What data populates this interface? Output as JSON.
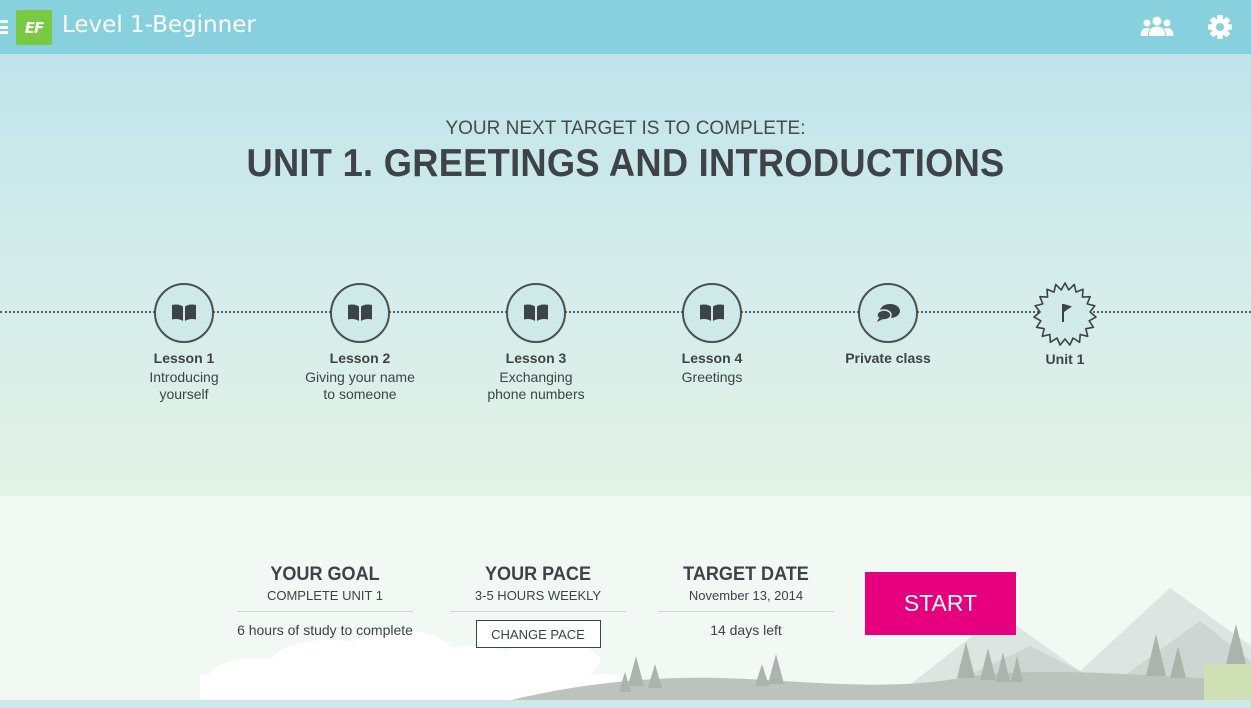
{
  "topbar": {
    "logo_text": "EF",
    "title": "Level 1-Beginner",
    "icons": [
      "menu-icon",
      "people-icon",
      "gear-icon"
    ]
  },
  "hero": {
    "kicker": "YOUR NEXT TARGET IS TO COMPLETE:",
    "unit_title": "UNIT 1. GREETINGS AND INTRODUCTIONS",
    "steps": [
      {
        "name": "Lesson 1",
        "desc": "Introducing yourself",
        "icon": "book-icon"
      },
      {
        "name": "Lesson 2",
        "desc": "Giving your name to someone",
        "icon": "book-icon"
      },
      {
        "name": "Lesson 3",
        "desc": "Exchanging phone numbers",
        "icon": "book-icon"
      },
      {
        "name": "Lesson 4",
        "desc": "Greetings",
        "icon": "book-icon"
      },
      {
        "name": "Private class",
        "desc": "",
        "icon": "chat-icon"
      },
      {
        "name": "Unit 1",
        "desc": "",
        "icon": "flag-badge-icon"
      }
    ]
  },
  "goal": {
    "head": "YOUR GOAL",
    "sub": "COMPLETE UNIT 1",
    "note": "6 hours of study to complete"
  },
  "pace": {
    "head": "YOUR PACE",
    "sub": "3-5 HOURS WEEKLY",
    "button": "CHANGE PACE"
  },
  "target": {
    "head": "TARGET DATE",
    "sub": "November 13, 2014",
    "note": "14 days left"
  },
  "start_label": "START",
  "colors": {
    "topbar": "#86d1dd",
    "logo": "#7ac943",
    "start": "#e6007e",
    "text": "#3d4347"
  }
}
